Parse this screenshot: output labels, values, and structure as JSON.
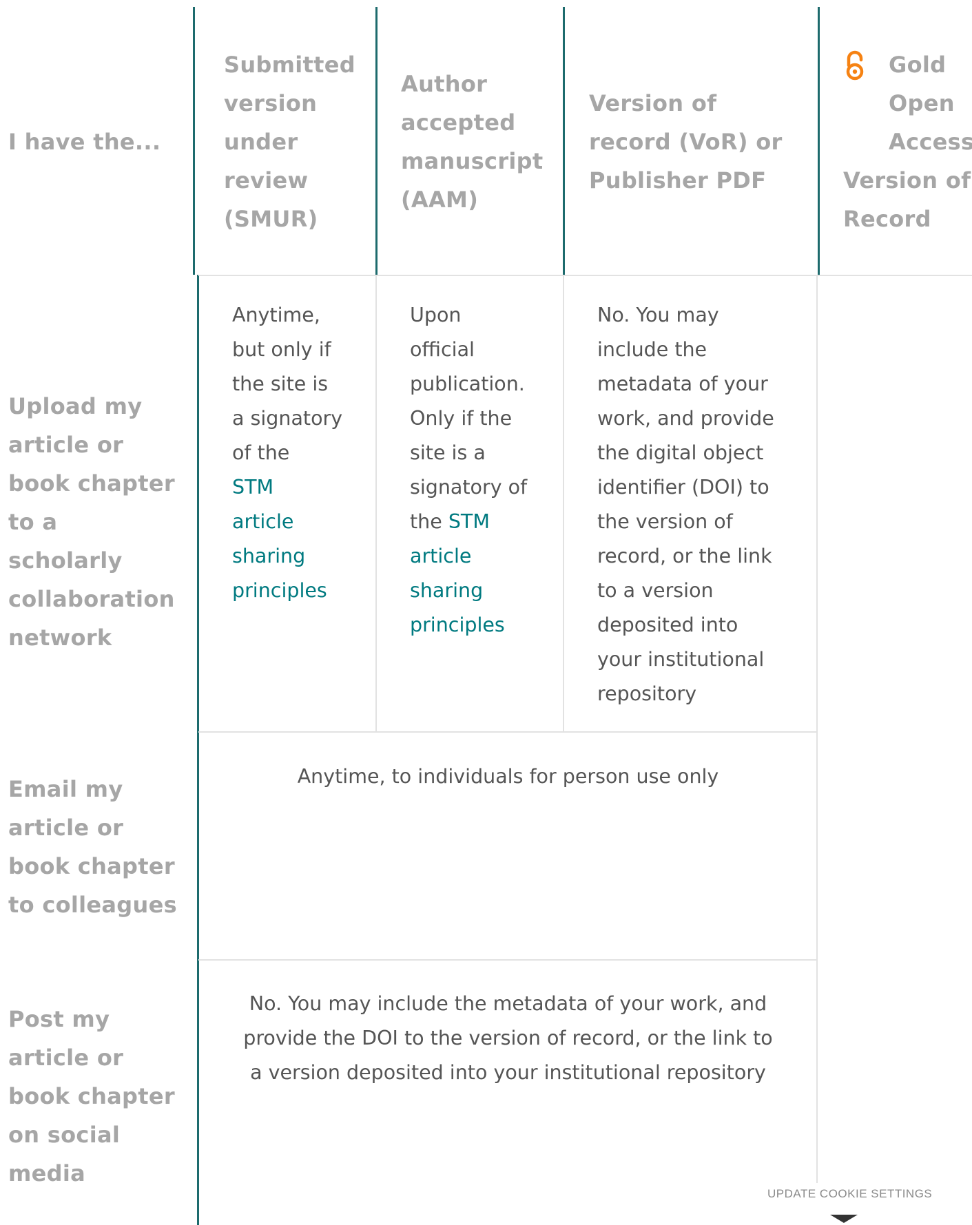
{
  "header": {
    "row_label": "I have the...",
    "col_smur": [
      "Submitted",
      "version",
      "under",
      "review",
      "(SMUR)"
    ],
    "col_aam": [
      "Author",
      "accepted",
      "manuscript",
      "(AAM)"
    ],
    "col_vor": [
      "Version of",
      "record (VoR) or",
      "Publisher PDF"
    ],
    "col_gold_top": [
      "Gold",
      "Open",
      "Access"
    ],
    "col_gold_bottom": [
      "Version of",
      "Record"
    ],
    "gold_icon": "open-access-lock-icon",
    "gold_icon_color": "#f68212"
  },
  "rows": {
    "upload": {
      "label": [
        "Upload my",
        "article or",
        "book chapter",
        "to a scholarly",
        "collaboration",
        "network"
      ],
      "smur_text": [
        "Anytime,",
        "but only if",
        "the site is",
        "a signatory",
        "of the"
      ],
      "smur_link": [
        "STM",
        "article",
        "sharing",
        "principles"
      ],
      "aam_text": [
        "Upon",
        "official",
        "publication.",
        "Only if the",
        "site is a",
        "signatory of"
      ],
      "aam_text_prefix": "the ",
      "aam_link_first": "STM",
      "aam_link": [
        "article",
        "sharing",
        "principles"
      ],
      "vor_text": [
        "No. You may",
        "include the",
        "metadata of your",
        "work, and provide",
        "the digital object",
        "identifier (DOI) to",
        "the version of",
        "record, or the link",
        "to a version",
        "deposited into",
        "your institutional",
        "repository"
      ]
    },
    "email": {
      "label": [
        "Email my",
        "article or",
        "book chapter",
        "to colleagues"
      ],
      "text": "Anytime, to individuals for person use only"
    },
    "social": {
      "label": [
        "Post my",
        "article or",
        "book chapter",
        "on social",
        "media"
      ],
      "text": [
        "No. You may include the metadata of your work, and",
        "provide the DOI to the version of record, or the link to",
        "a version deposited into your institutional repository"
      ]
    }
  },
  "cookie": {
    "label": "UPDATE COOKIE SETTINGS"
  },
  "colors": {
    "accent_teal": "#1d6b6d",
    "link_teal": "#007a80",
    "heading_gray": "#a6a6a6",
    "oa_orange": "#f68212"
  }
}
